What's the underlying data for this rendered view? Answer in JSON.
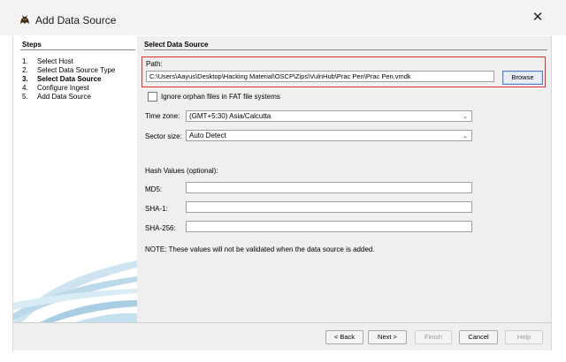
{
  "window": {
    "title": "Add Data Source",
    "app_icon": "autopsy-dog-icon",
    "close_icon": "close-icon",
    "close_glyph": "✕"
  },
  "steps": {
    "title": "Steps",
    "items": [
      {
        "num": "1.",
        "label": "Select Host"
      },
      {
        "num": "2.",
        "label": "Select Data Source Type"
      },
      {
        "num": "3.",
        "label": "Select Data Source",
        "current": true
      },
      {
        "num": "4.",
        "label": "Configure Ingest"
      },
      {
        "num": "5.",
        "label": "Add Data Source"
      }
    ]
  },
  "main": {
    "title": "Select Data Source",
    "path_label": "Path:",
    "path_value": "C:\\Users\\Aayus\\Desktop\\Hacking Material\\OSCP\\Zips\\VulnHub\\Prac Pen\\Prac Pen.vmdk",
    "browse_label": "Browse",
    "ignore_orphan_label": "Ignore orphan files in FAT file systems",
    "ignore_orphan_checked": false,
    "timezone_label": "Time zone:",
    "timezone_value": "(GMT+5:30) Asia/Calcutta",
    "sector_label": "Sector size:",
    "sector_value": "Auto Detect",
    "hash_label": "Hash Values (optional):",
    "md5_label": "MD5:",
    "sha1_label": "SHA-1:",
    "sha256_label": "SHA-256:",
    "md5_value": "",
    "sha1_value": "",
    "sha256_value": "",
    "note": "NOTE: These values will not be validated when the data source is added."
  },
  "footer": {
    "back_label": "< Back",
    "next_label": "Next >",
    "finish_label": "Finish",
    "cancel_label": "Cancel",
    "help_label": "Help"
  },
  "colors": {
    "highlight_border": "#e03030",
    "browse_border": "#5a7fb8",
    "waves": "#bcd9ea"
  }
}
